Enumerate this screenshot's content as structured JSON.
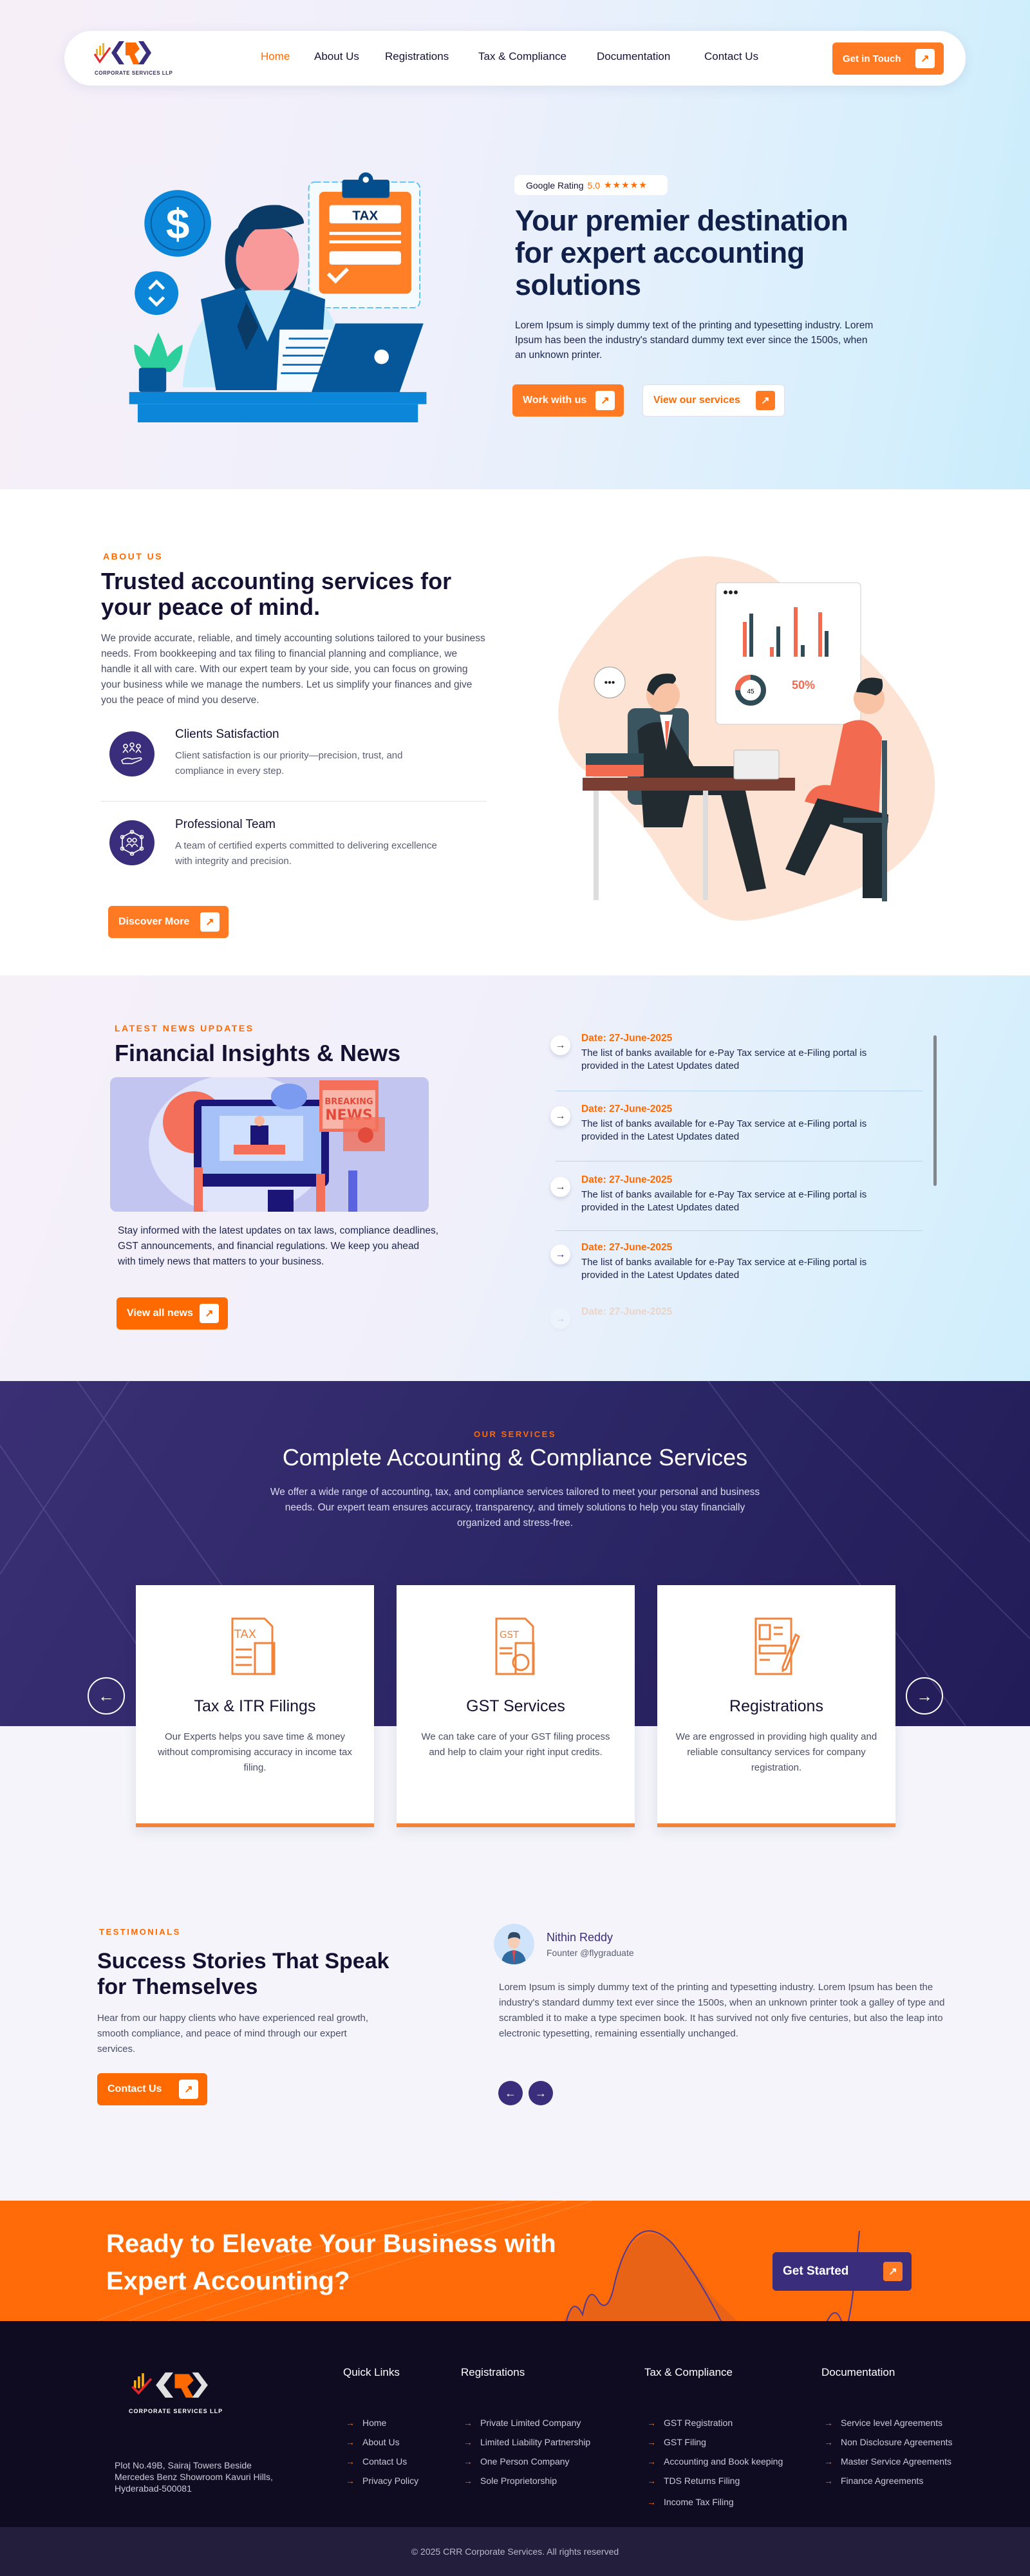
{
  "brand": {
    "logo_text": "CRR",
    "logo_sub": "CORPORATE SERVICES LLP",
    "accent": "#ff6a00",
    "purple": "#3a2d7b"
  },
  "nav": {
    "items": [
      {
        "label": "Home",
        "active": true
      },
      {
        "label": "About Us"
      },
      {
        "label": "Registrations"
      },
      {
        "label": "Tax & Compliance"
      },
      {
        "label": "Documentation"
      },
      {
        "label": "Contact Us"
      }
    ],
    "cta": "Get in Touch"
  },
  "hero": {
    "rating_label": "Google Rating",
    "rating_value": "5.0",
    "stars": "★★★★★",
    "title": "Your premier destination for expert accounting solutions",
    "text": "Lorem Ipsum is simply dummy text of the printing and typesetting industry. Lorem Ipsum has been the industry's standard dummy text ever since the 1500s, when an unknown printer.",
    "primary_btn": "Work with us",
    "secondary_btn": "View our services",
    "illustration_label": "TAX"
  },
  "about": {
    "eyebrow": "ABOUT US",
    "title": "Trusted accounting services for your peace of mind.",
    "text": "We provide accurate, reliable, and timely accounting solutions tailored to your business needs. From bookkeeping and tax filing to financial planning and compliance, we handle it all with care. With our expert team by your side, you can focus on growing your business while we manage the numbers. Let us simplify your finances and give you the peace of mind you deserve.",
    "features": [
      {
        "title": "Clients Satisfaction",
        "desc": "Client satisfaction is our priority—precision, trust, and compliance in every step."
      },
      {
        "title": "Professional Team",
        "desc": "A team of certified experts committed to delivering excellence with integrity and precision."
      }
    ],
    "button": "Discover More",
    "illustration_stats": {
      "donut": "45",
      "percent": "50%"
    }
  },
  "news": {
    "eyebrow": "LATEST NEWS UPDATES",
    "title": "Financial Insights & News",
    "image_text": [
      "BREAKING",
      "NEWS"
    ],
    "text": "Stay informed with the latest updates on tax laws, compliance deadlines, GST announcements, and financial regulations. We keep you ahead with timely news that matters to your business.",
    "button": "View all news",
    "items": [
      {
        "date": "Date: 27-June-2025",
        "text": "The list of banks available for e-Pay Tax service at e-Filing portal is provided in the Latest Updates dated"
      },
      {
        "date": "Date: 27-June-2025",
        "text": "The list of banks available for e-Pay Tax service at e-Filing portal is provided in the Latest Updates dated"
      },
      {
        "date": "Date: 27-June-2025",
        "text": "The list of banks available for e-Pay Tax service at e-Filing portal is provided in the Latest Updates dated"
      },
      {
        "date": "Date: 27-June-2025",
        "text": "The list of banks available for e-Pay Tax service at e-Filing portal is provided in the Latest Updates dated"
      },
      {
        "date": "Date: 27-June-2025"
      }
    ]
  },
  "services": {
    "eyebrow": "OUR SERVICES",
    "title": "Complete Accounting & Compliance Services",
    "text": "We offer a wide range of accounting, tax, and compliance services tailored to meet your personal and business needs. Our expert team ensures accuracy, transparency, and timely solutions to help you stay financially organized and stress-free.",
    "cards": [
      {
        "title": "Tax & ITR Filings",
        "desc": "Our Experts helps you save time & money without compromising accuracy in income tax filing.",
        "icon_text": "TAX"
      },
      {
        "title": "GST Services",
        "desc": "We can take care of your GST filing process and help to claim your right input credits.",
        "icon_text": "GST"
      },
      {
        "title": "Registrations",
        "desc": "We are engrossed in providing high quality and reliable consultancy services for company registration."
      }
    ]
  },
  "testimonials": {
    "eyebrow": "TESTIMONIALS",
    "title": "Success Stories That Speak for Themselves",
    "text": "Hear from our happy clients who have experienced real growth, smooth compliance, and peace of mind through our expert services.",
    "button": "Contact Us",
    "name": "Nithin Reddy",
    "role": "Founter @flygraduate",
    "quote": "Lorem Ipsum is simply dummy text of the printing and typesetting industry. Lorem Ipsum has been the industry's standard dummy text ever since the 1500s, when an unknown printer took a galley of type and scrambled it to make a type specimen book. It has survived not only five centuries, but also the leap into electronic typesetting, remaining essentially unchanged."
  },
  "cta": {
    "title": "Ready to Elevate Your Business with Expert Accounting?",
    "button": "Get Started"
  },
  "footer": {
    "address": "Plot No.49B, Sairaj Towers Beside Mercedes Benz Showroom Kavuri Hills, Hyderabad-500081",
    "columns": [
      {
        "title": "Quick Links",
        "links": [
          "Home",
          "About Us",
          "Contact Us",
          "Privacy Policy"
        ]
      },
      {
        "title": "Registrations",
        "links": [
          "Private Limited Company",
          "Limited Liability Partnership",
          "One Person Company",
          "Sole Proprietorship"
        ]
      },
      {
        "title": "Tax & Compliance",
        "links": [
          "GST Registration",
          "GST Filing",
          "Accounting and Book keeping",
          "TDS Returns Filing",
          "Income Tax Filing"
        ]
      },
      {
        "title": "Documentation",
        "links": [
          "Service level Agreements",
          "Non Disclosure Agreements",
          "Master Service Agreements",
          "Finance Agreements"
        ]
      }
    ],
    "copyright": "© 2025 CRR Corporate Services. All rights reserved"
  }
}
